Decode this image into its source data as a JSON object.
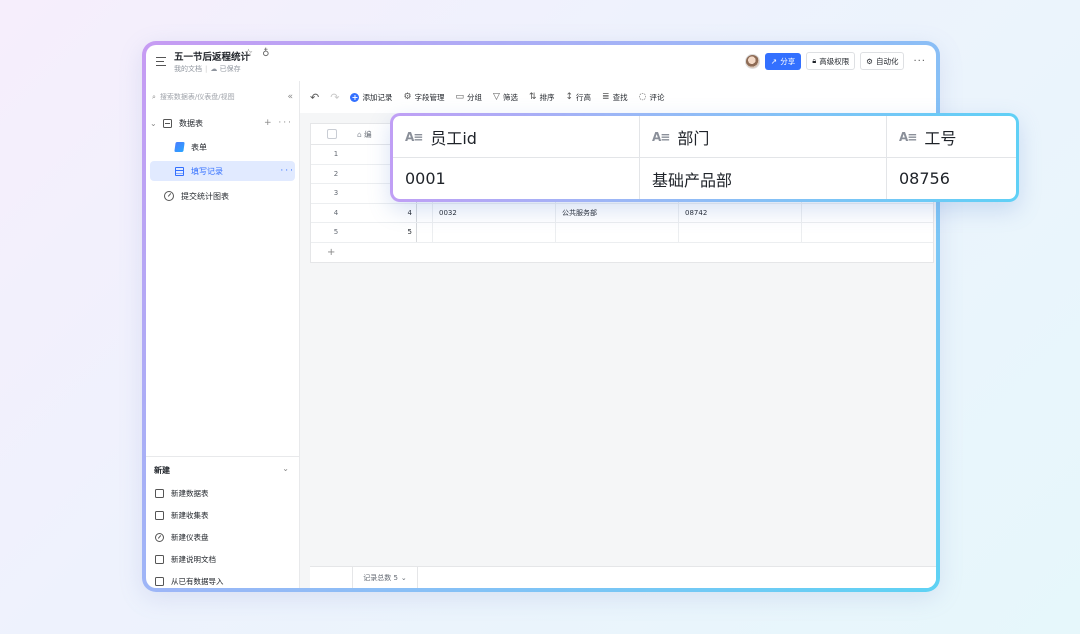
{
  "doc": {
    "title": "五一节后返程统计",
    "breadcrumb": "我的文档",
    "save_status": "已保存"
  },
  "topbar": {
    "share_label": "分享",
    "permission_label": "高级权限",
    "automation_label": "自动化",
    "more_label": "···"
  },
  "sidebar": {
    "search_placeholder": "搜索数据表/仪表盘/视图",
    "items": [
      {
        "label": "数据表",
        "icon": "table-icon"
      },
      {
        "label": "表单",
        "icon": "form-icon"
      },
      {
        "label": "填写记录",
        "icon": "grid-view-icon"
      },
      {
        "label": "提交统计图表",
        "icon": "dashboard-icon"
      }
    ],
    "new_section": {
      "title": "新建",
      "items": [
        {
          "label": "新建数据表",
          "icon": "table-icon"
        },
        {
          "label": "新建收集表",
          "icon": "form-icon"
        },
        {
          "label": "新建仪表盘",
          "icon": "dashboard-icon"
        },
        {
          "label": "新建说明文档",
          "icon": "doc-icon"
        },
        {
          "label": "从已有数据导入",
          "icon": "import-icon"
        }
      ]
    }
  },
  "toolbar": {
    "add_record": "添加记录",
    "field_manage": "字段管理",
    "group": "分组",
    "filter": "筛选",
    "sort": "排序",
    "row_height": "行高",
    "search": "查找",
    "comment": "评论"
  },
  "table": {
    "first_col_header": "编",
    "rows": [
      {
        "index": "1",
        "id": "",
        "col2": "",
        "col3": "",
        "col4": ""
      },
      {
        "index": "2",
        "id": "",
        "col2": "",
        "col3": "",
        "col4": ""
      },
      {
        "index": "3",
        "id": "",
        "col2": "",
        "col3": "",
        "col4": ""
      },
      {
        "index": "4",
        "id": "4",
        "col2": "0032",
        "col3": "公共服务部",
        "col4": "08742"
      },
      {
        "index": "5",
        "id": "5",
        "col2": "",
        "col3": "",
        "col4": ""
      }
    ],
    "add_row": "+",
    "record_count": "记录总数 5"
  },
  "callout": {
    "columns": [
      {
        "header": "员工id",
        "value": "0001"
      },
      {
        "header": "部门",
        "value": "基础产品部"
      },
      {
        "header": "工号",
        "value": "08756"
      }
    ]
  }
}
